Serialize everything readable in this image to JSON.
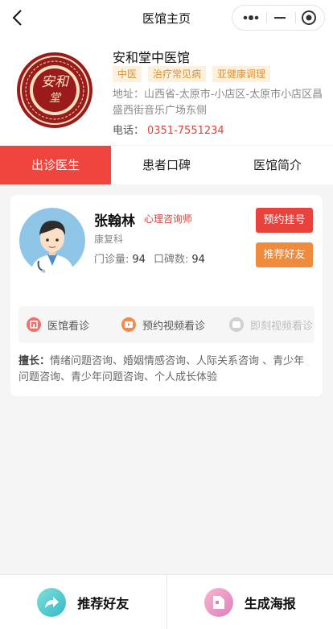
{
  "nav": {
    "title": "医馆主页",
    "back_icon": "back-arrow-icon",
    "more_icon": "more-dots-icon",
    "minimize_icon": "minimize-icon",
    "close_icon": "target-icon"
  },
  "clinic": {
    "name": "安和堂中医馆",
    "logo_text": "安和堂",
    "tags": [
      "中医",
      "治疗常见病",
      "亚健康调理"
    ],
    "address": "地址：山西省-太原市-小店区-太原市小店区昌盛西街音乐广场东侧",
    "phone_label": "电话：",
    "phone": "0351-7551234"
  },
  "tabs": [
    {
      "label": "出诊医生",
      "active": true
    },
    {
      "label": "患者口碑",
      "active": false
    },
    {
      "label": "医馆简介",
      "active": false
    }
  ],
  "doctor": {
    "name": "张翰林",
    "title": "心理咨询师",
    "department": "康复科",
    "visits_label": "门诊量:",
    "visits": "94",
    "reviews_label": "口碑数:",
    "reviews": "94",
    "book_label": "预约挂号",
    "recommend_label": "推荐好友",
    "services": [
      {
        "label": "医馆看诊",
        "icon": "clinic-visit-icon",
        "enabled": true,
        "color": "#f0716b"
      },
      {
        "label": "预约视频看诊",
        "icon": "video-play-icon",
        "enabled": true,
        "color": "#f5894a"
      },
      {
        "label": "即刻视频看诊",
        "icon": "video-chat-icon",
        "enabled": false,
        "color": "#d0d0d0"
      }
    ],
    "specialty_label": "擅长：",
    "specialty": "情绪问题咨询、婚姻情感咨询、人际关系咨询 、青少年问题咨询、青少年问题咨询、个人成长体验"
  },
  "bottom": {
    "share_label": "推荐好友",
    "share_icon": "share-arrow-icon",
    "poster_label": "生成海报",
    "poster_icon": "poster-icon"
  },
  "colors": {
    "accent": "#f0453f",
    "orange": "#f08a3d",
    "tag_bg": "#fdf0dc",
    "tag_text": "#d9923a"
  }
}
